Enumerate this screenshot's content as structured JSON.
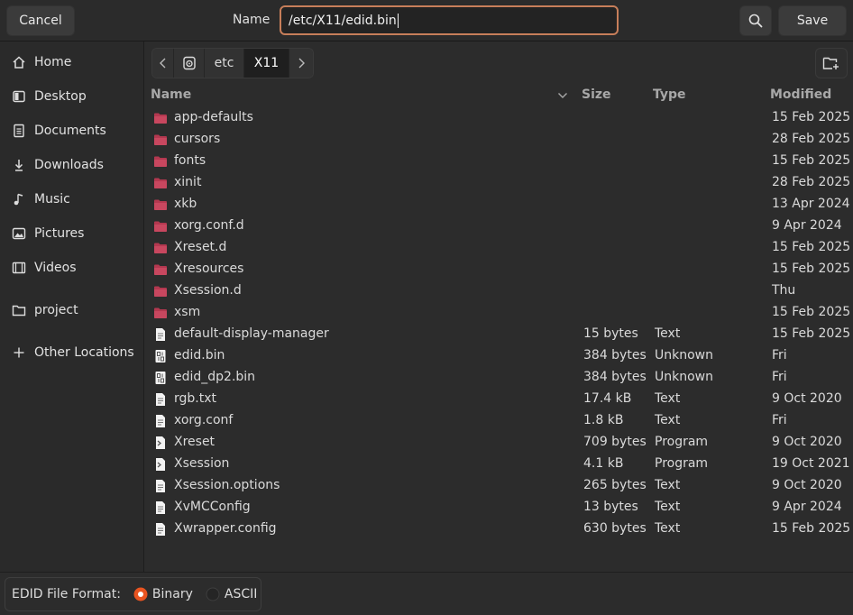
{
  "header": {
    "cancel_label": "Cancel",
    "name_label": "Name",
    "name_value": "/etc/X11/edid.bin",
    "save_label": "Save"
  },
  "sidebar": {
    "items": [
      {
        "label": "Home",
        "icon": "home-icon"
      },
      {
        "label": "Desktop",
        "icon": "desktop-icon"
      },
      {
        "label": "Documents",
        "icon": "documents-icon"
      },
      {
        "label": "Downloads",
        "icon": "downloads-icon"
      },
      {
        "label": "Music",
        "icon": "music-icon"
      },
      {
        "label": "Pictures",
        "icon": "pictures-icon"
      },
      {
        "label": "Videos",
        "icon": "videos-icon"
      },
      {
        "label": "project",
        "icon": "folder-icon"
      },
      {
        "label": "Other Locations",
        "icon": "plus-icon"
      }
    ]
  },
  "pathbar": {
    "segments": [
      "etc",
      "X11"
    ]
  },
  "columns": {
    "name": "Name",
    "size": "Size",
    "type": "Type",
    "modified": "Modified"
  },
  "files": [
    {
      "name": "app-defaults",
      "kind": "folder",
      "size": "",
      "type": "",
      "modified": "15 Feb 2025"
    },
    {
      "name": "cursors",
      "kind": "folder",
      "size": "",
      "type": "",
      "modified": "28 Feb 2025"
    },
    {
      "name": "fonts",
      "kind": "folder",
      "size": "",
      "type": "",
      "modified": "15 Feb 2025"
    },
    {
      "name": "xinit",
      "kind": "folder",
      "size": "",
      "type": "",
      "modified": "28 Feb 2025"
    },
    {
      "name": "xkb",
      "kind": "folder",
      "size": "",
      "type": "",
      "modified": "13 Apr 2024"
    },
    {
      "name": "xorg.conf.d",
      "kind": "folder",
      "size": "",
      "type": "",
      "modified": "9 Apr 2024"
    },
    {
      "name": "Xreset.d",
      "kind": "folder",
      "size": "",
      "type": "",
      "modified": "15 Feb 2025"
    },
    {
      "name": "Xresources",
      "kind": "folder",
      "size": "",
      "type": "",
      "modified": "15 Feb 2025"
    },
    {
      "name": "Xsession.d",
      "kind": "folder",
      "size": "",
      "type": "",
      "modified": "Thu"
    },
    {
      "name": "xsm",
      "kind": "folder",
      "size": "",
      "type": "",
      "modified": "15 Feb 2025"
    },
    {
      "name": "default-display-manager",
      "kind": "text",
      "size": "15 bytes",
      "type": "Text",
      "modified": "15 Feb 2025"
    },
    {
      "name": "edid.bin",
      "kind": "binary",
      "size": "384 bytes",
      "type": "Unknown",
      "modified": "Fri"
    },
    {
      "name": "edid_dp2.bin",
      "kind": "binary",
      "size": "384 bytes",
      "type": "Unknown",
      "modified": "Fri"
    },
    {
      "name": "rgb.txt",
      "kind": "text",
      "size": "17.4 kB",
      "type": "Text",
      "modified": "9 Oct 2020"
    },
    {
      "name": "xorg.conf",
      "kind": "text",
      "size": "1.8 kB",
      "type": "Text",
      "modified": "Fri"
    },
    {
      "name": "Xreset",
      "kind": "script",
      "size": "709 bytes",
      "type": "Program",
      "modified": "9 Oct 2020"
    },
    {
      "name": "Xsession",
      "kind": "script",
      "size": "4.1 kB",
      "type": "Program",
      "modified": "19 Oct 2021"
    },
    {
      "name": "Xsession.options",
      "kind": "text",
      "size": "265 bytes",
      "type": "Text",
      "modified": "9 Oct 2020"
    },
    {
      "name": "XvMCConfig",
      "kind": "text",
      "size": "13 bytes",
      "type": "Text",
      "modified": "9 Apr 2024"
    },
    {
      "name": "Xwrapper.config",
      "kind": "text",
      "size": "630 bytes",
      "type": "Text",
      "modified": "15 Feb 2025"
    }
  ],
  "footer": {
    "format_label": "EDID File Format:",
    "options": [
      {
        "label": "Binary",
        "selected": true
      },
      {
        "label": "ASCII",
        "selected": false
      }
    ]
  },
  "colors": {
    "accent": "#e95420",
    "focus_border": "#c77e5a",
    "folder": "#b3384f"
  }
}
